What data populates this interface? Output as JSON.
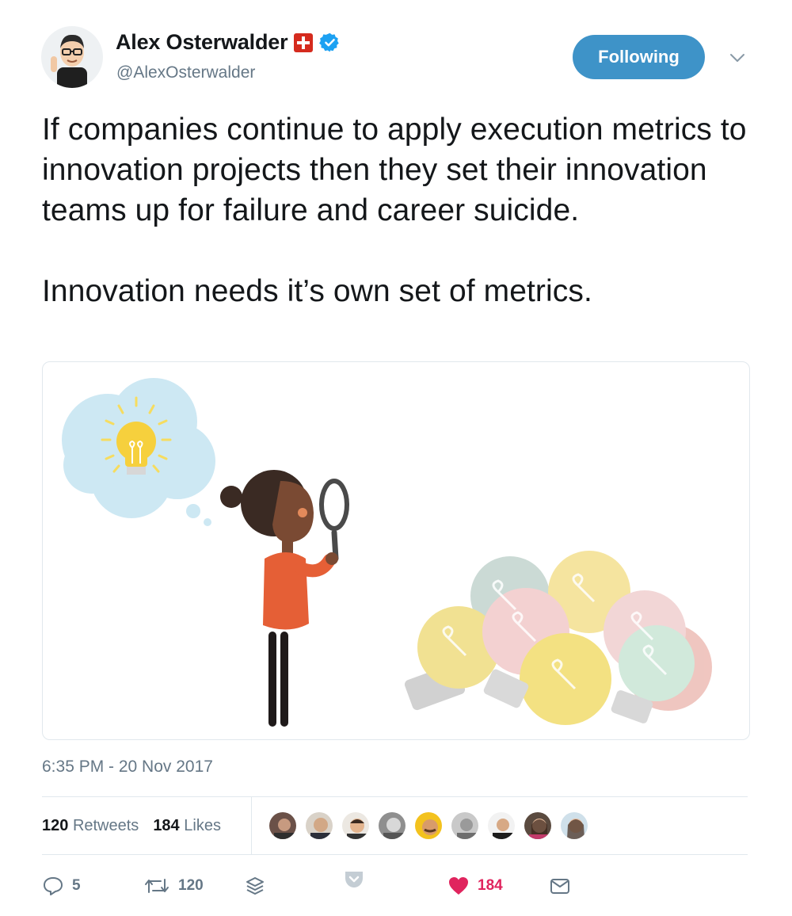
{
  "author": {
    "display_name": "Alex Osterwalder",
    "handle": "@AlexOsterwalder",
    "flag_icon": "swiss-flag-icon",
    "verified_icon": "verified-badge-icon"
  },
  "follow_button": {
    "label": "Following",
    "color": "#3e93c8"
  },
  "tweet": {
    "paragraphs": [
      "If companies continue to apply execution metrics to innovation projects then they set their innovation teams up for failure and career suicide.",
      "Innovation needs it’s own set of metrics."
    ]
  },
  "timestamp": "6:35 PM - 20 Nov 2017",
  "stats": {
    "retweets_count": "120",
    "retweets_label": "Retweets",
    "likes_count": "184",
    "likes_label": "Likes"
  },
  "actions": {
    "reply_count": "5",
    "retweet_count": "120",
    "like_count": "184"
  },
  "colors": {
    "like": "#e0245e",
    "muted": "#657786",
    "text": "#14171a"
  }
}
